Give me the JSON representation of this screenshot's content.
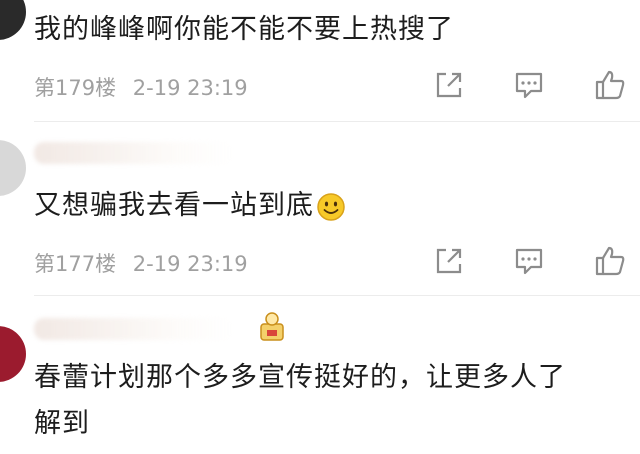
{
  "comments": [
    {
      "text": "我的峰峰啊你能不能不要上热搜了",
      "floor": "第179楼",
      "date": "2-19 23:19"
    },
    {
      "text": "又想骗我去看一站到底",
      "floor": "第177楼",
      "date": "2-19 23:19",
      "emoji": "smile-emoji"
    },
    {
      "text_line1": "春蕾计划那个多多宣传挺好的，让更多人了",
      "text_line2": "解到"
    }
  ],
  "icons": {
    "share": "share-icon",
    "comment": "comment-icon",
    "like": "like-icon"
  },
  "colors": {
    "meta_text": "#a0a0a0",
    "icon": "#8c8c8c",
    "avatar_red": "#9b1b2e"
  }
}
